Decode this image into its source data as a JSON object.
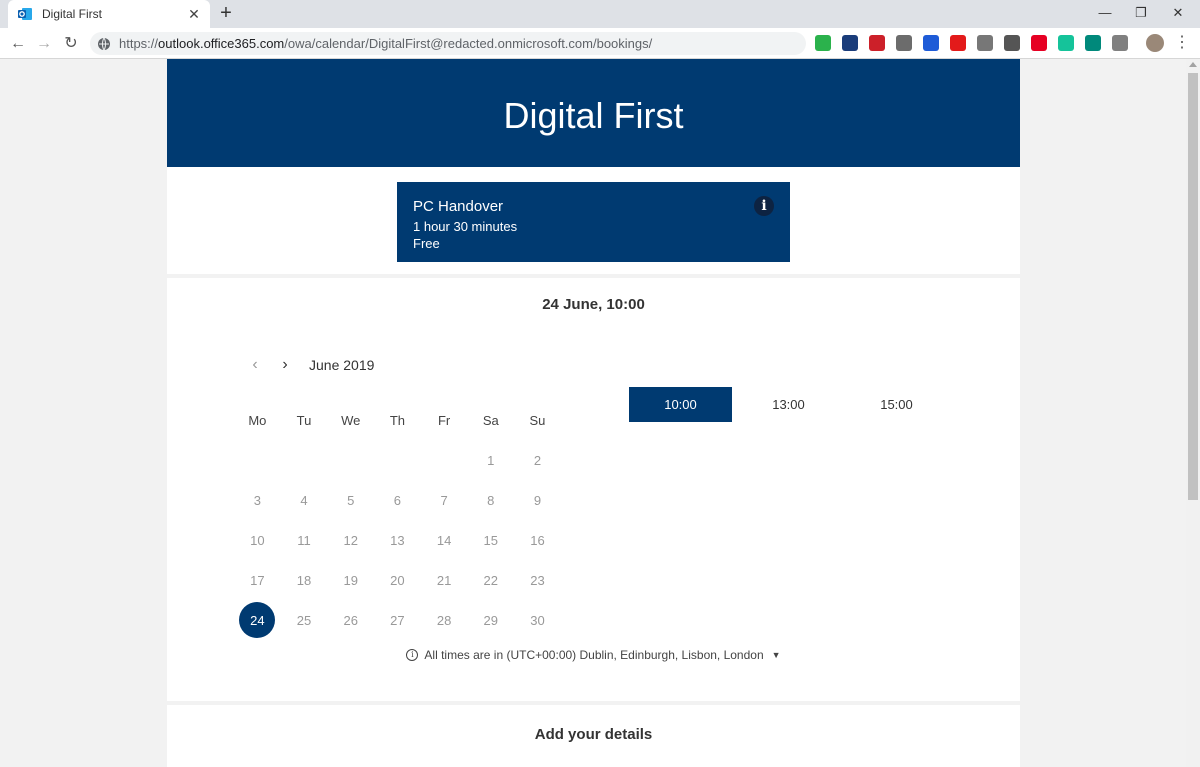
{
  "browser": {
    "tab_title": "Digital First",
    "url_prefix": "https://",
    "url_host": "outlook.office365.com",
    "url_path": "/owa/calendar/DigitalFirst@redacted.onmicrosoft.com/bookings/",
    "extensions": [
      {
        "name": "feedly-icon",
        "color": "#2bb24c"
      },
      {
        "name": "vimeo-icon",
        "color": "#1a3c7a"
      },
      {
        "name": "lastpass-icon",
        "color": "#cc2029"
      },
      {
        "name": "ghostery-icon",
        "color": "#6c6c6c"
      },
      {
        "name": "grid-icon",
        "color": "#1e5bd7"
      },
      {
        "name": "opera-icon",
        "color": "#e31a1a"
      },
      {
        "name": "camera-icon",
        "color": "#777777"
      },
      {
        "name": "comment-icon",
        "color": "#555555"
      },
      {
        "name": "pinterest-icon",
        "color": "#e60023"
      },
      {
        "name": "grammarly-icon",
        "color": "#15c39a"
      },
      {
        "name": "tampermonkey-icon",
        "color": "#00897b"
      },
      {
        "name": "drive-icon",
        "color": "#808080"
      }
    ]
  },
  "page": {
    "business_name": "Digital First",
    "service": {
      "name": "PC Handover",
      "duration": "1 hour 30 minutes",
      "price": "Free",
      "info_label": "i"
    },
    "selected_summary": "24 June, 10:00",
    "calendar": {
      "month_label": "June 2019",
      "weekdays": [
        "Mo",
        "Tu",
        "We",
        "Th",
        "Fr",
        "Sa",
        "Su"
      ],
      "weeks": [
        [
          "",
          "",
          "",
          "",
          "",
          "1",
          "2"
        ],
        [
          "3",
          "4",
          "5",
          "6",
          "7",
          "8",
          "9"
        ],
        [
          "10",
          "11",
          "12",
          "13",
          "14",
          "15",
          "16"
        ],
        [
          "17",
          "18",
          "19",
          "20",
          "21",
          "22",
          "23"
        ],
        [
          "24",
          "25",
          "26",
          "27",
          "28",
          "29",
          "30"
        ]
      ],
      "selected_day": "24"
    },
    "time_slots": [
      "10:00",
      "13:00",
      "15:00"
    ],
    "selected_slot": "10:00",
    "timezone_prefix": "All times are in",
    "timezone": "(UTC+00:00) Dublin, Edinburgh, Lisbon, London",
    "details_title": "Add your details"
  },
  "colors": {
    "brand": "#003a71"
  }
}
